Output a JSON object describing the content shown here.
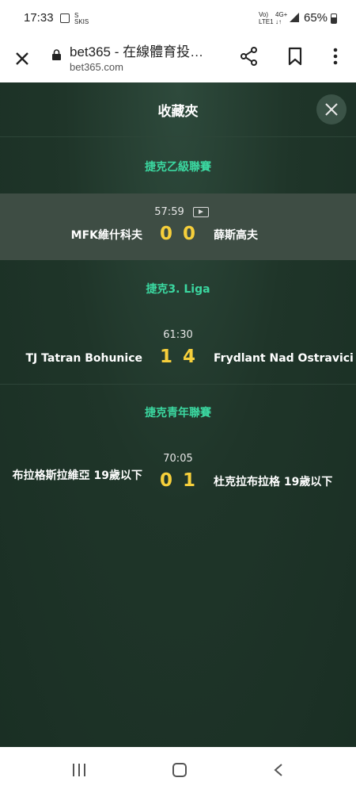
{
  "status_bar": {
    "time": "17:33",
    "icon2_text": "S\nSKIS",
    "network_left": "Vo)\nLTE1",
    "network_right": "4G+\n↓↑",
    "battery_text": "65%"
  },
  "browser": {
    "title": "bet365 - 在線體育投…",
    "url": "bet365.com",
    "icons": [
      "close-icon",
      "lock-icon",
      "share-icon",
      "bookmark-icon",
      "more-vert-icon"
    ]
  },
  "favorites": {
    "title": "收藏夾",
    "sections": [
      {
        "league": "捷克乙級聯賽",
        "match": {
          "time": "57:59",
          "home": "MFK維什科夫",
          "home_score": "0",
          "away_score": "0",
          "away": "薛斯高夫",
          "has_video": true
        }
      },
      {
        "league": "捷克3. Liga",
        "match": {
          "time": "61:30",
          "home": "TJ Tatran Bohunice",
          "home_score": "1",
          "away_score": "4",
          "away": "Frydlant Nad Ostravici",
          "has_video": false
        }
      },
      {
        "league": "捷克青年聯賽",
        "match": {
          "time": "70:05",
          "home": "布拉格斯拉維亞 19歲以下",
          "home_score": "0",
          "away_score": "1",
          "away": "杜克拉布拉格 19歲以下",
          "has_video": false
        }
      }
    ]
  },
  "colors": {
    "league": "#3bd7a0",
    "score": "#f6cf3b",
    "background": "#1f3529",
    "highlight_row": "#3e4d44"
  },
  "navbar": {
    "icons": [
      "recent-apps-icon",
      "home-icon",
      "back-icon"
    ]
  }
}
